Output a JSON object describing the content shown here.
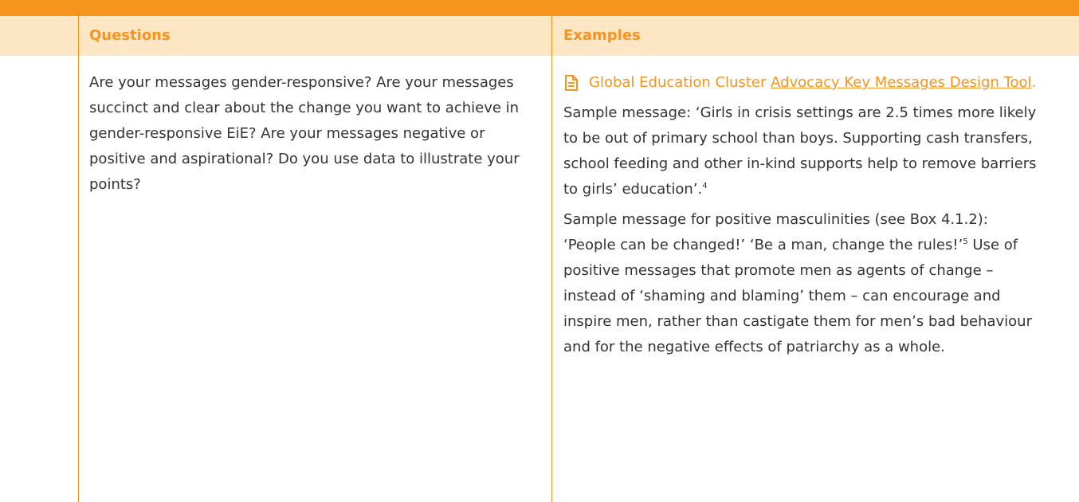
{
  "table": {
    "headers": {
      "questions": "Questions",
      "examples": "Examples"
    },
    "row": {
      "questions_text": "Are your messages gender-responsive? Are your messages succinct and clear about the change you want to achieve in gender-responsive EiE? Are your messages negative or positive and aspirational? Do you use data to illustrate your points?",
      "examples": {
        "tool_prefix": "Global Education Cluster ",
        "tool_link": "Advocacy Key Messages Design Tool",
        "tool_suffix": ".",
        "tool_icon": "document-icon",
        "sample1_text": "Sample message: ‘Girls in crisis settings are 2.5 times more likely to be out of primary school than boys. Supporting cash transfers, school feeding and other in-kind supports help to remove barriers to girls’ education’.",
        "sample1_footnote": "4",
        "sample2_line1": "Sample message for positive masculinities (see Box 4.1.2): ‘People can be changed!’ ‘Be a man, change the rules!’",
        "sample2_footnote": "5",
        "sample2_text": "Use of positive messages that promote men as agents of change – instead of ‘shaming and blaming’ them – can encourage and inspire men, rather than castigate them for men’s bad behaviour and for the negative effects of patriarchy as a whole."
      }
    }
  },
  "colors": {
    "accent": "#f7941d",
    "header_bg": "#fde6c4",
    "text": "#333333"
  }
}
